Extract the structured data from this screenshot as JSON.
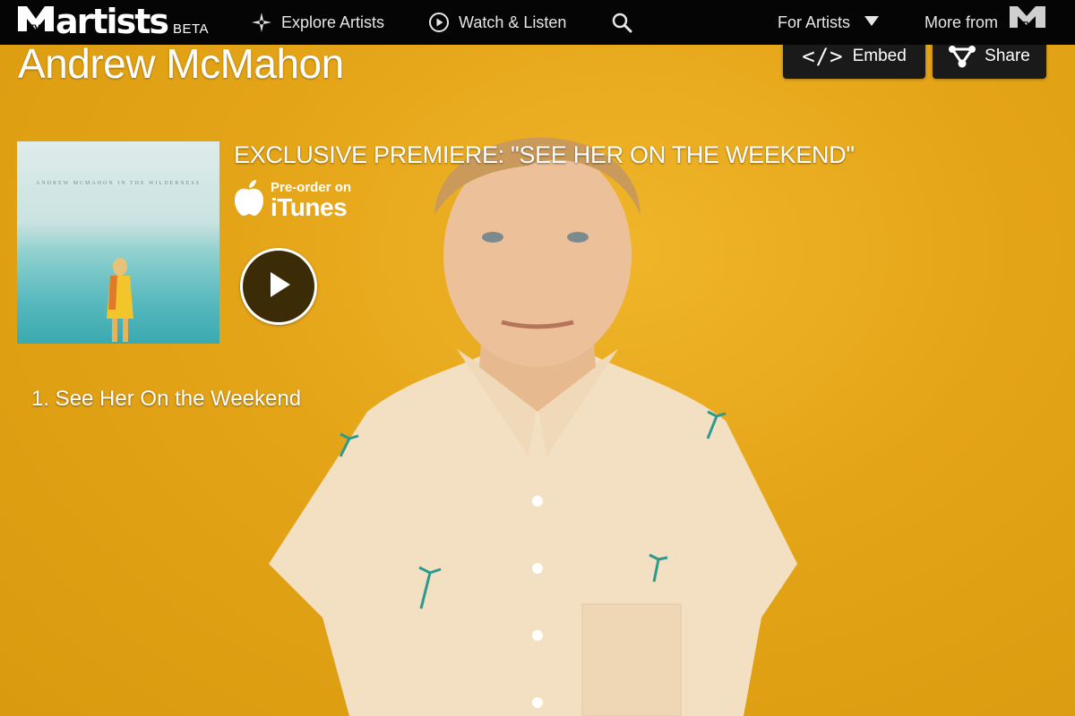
{
  "nav": {
    "logo_text": "artists",
    "logo_badge": "BETA",
    "explore_label": "Explore Artists",
    "watch_label": "Watch & Listen",
    "for_artists_label": "For Artists",
    "more_from_label": "More from",
    "icons": [
      "mtv-logo-icon",
      "compass-star-icon",
      "play-circle-icon",
      "search-icon",
      "caret-down-icon",
      "mtv-badge-icon"
    ]
  },
  "header": {
    "artist_name": "Andrew McMahon",
    "embed_label": "Embed",
    "share_label": "Share"
  },
  "release": {
    "album_cover_text": "ANDREW MCMAHON IN THE WILDERNESS",
    "premiere_title": "EXCLUSIVE PREMIERE: \"SEE HER ON THE WEEKEND\"",
    "itunes_pre": "Pre-order on",
    "itunes_brand": "iTunes"
  },
  "tracks": [
    {
      "label": "1. See Her On the Weekend"
    }
  ],
  "colors": {
    "background": "#e2a314",
    "topbar": "#050505",
    "button": "#1a1a1a",
    "play": "#3b2b06"
  }
}
